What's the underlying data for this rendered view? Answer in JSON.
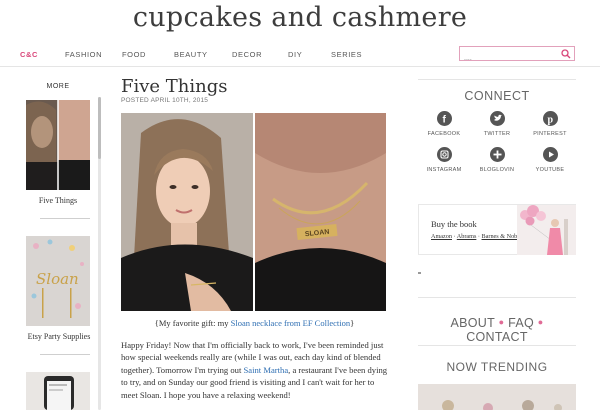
{
  "site": {
    "title": "cupcakes and cashmere"
  },
  "nav": {
    "items": [
      "C&C",
      "FASHION",
      "FOOD",
      "BEAUTY",
      "DECOR",
      "DIY",
      "SERIES"
    ]
  },
  "search": {
    "placeholder": "...."
  },
  "sidebar_left": {
    "more_label": "MORE",
    "items": [
      {
        "caption": "Five Things"
      },
      {
        "caption": "Etsy Party Supplies"
      },
      {
        "caption": ""
      }
    ]
  },
  "post": {
    "title": "Five Things",
    "date": "POSTED APRIL 10TH, 2015",
    "necklace_text": "SLOAN",
    "caption_pre": "{My favorite gift: my ",
    "caption_link": "Sloan necklace from EF Collection",
    "caption_post": "}",
    "body_1": "Happy Friday! Now that I'm officially back to work, I've been reminded just how special weekends really are (while I was out, each day kind of blended together). Tomorrow I'm trying out ",
    "body_link": "Saint Martha",
    "body_2": ", a restaurant I've been dying to try, and on Sunday our good friend is visiting and I can't wait for her to meet Sloan. I hope you have a relaxing weekend!"
  },
  "sidebar_right": {
    "connect_heading": "CONNECT",
    "social": [
      {
        "label": "FACEBOOK",
        "icon": "facebook-icon"
      },
      {
        "label": "TWITTER",
        "icon": "twitter-icon"
      },
      {
        "label": "PINTEREST",
        "icon": "pinterest-icon"
      },
      {
        "label": "INSTAGRAM",
        "icon": "instagram-icon"
      },
      {
        "label": "BLOGLOVIN",
        "icon": "bloglovin-icon"
      },
      {
        "label": "YOUTUBE",
        "icon": "youtube-icon"
      }
    ],
    "book": {
      "title": "Buy the book",
      "links": [
        "Amazon",
        "Abrams",
        "Barnes & Noble"
      ]
    },
    "links": [
      "ABOUT",
      "FAQ",
      "CONTACT"
    ],
    "trending_heading": "NOW TRENDING"
  },
  "colors": {
    "accent": "#d9477a",
    "link": "#2f6fb3"
  }
}
